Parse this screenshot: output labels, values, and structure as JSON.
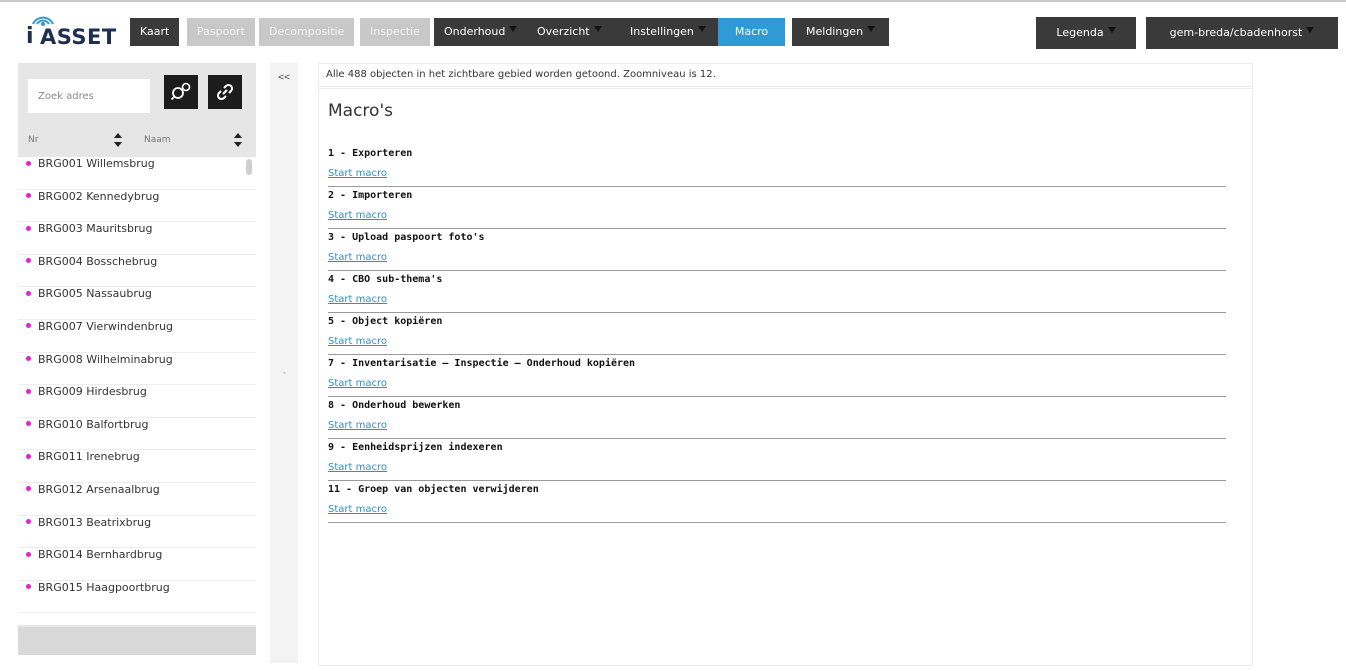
{
  "logo": {
    "text_i": "i",
    "text_asset": "ASSET"
  },
  "nav": {
    "kaart": "Kaart",
    "paspoort": "Paspoort",
    "decompositie": "Decompositie",
    "inspectie": "Inspectie",
    "onderhoud": "Onderhoud",
    "overzicht": "Overzicht",
    "instellingen": "Instellingen",
    "macro": "Macro",
    "meldingen": "Meldingen",
    "legenda": "Legenda",
    "user": "gem-breda/cbadenhorst"
  },
  "sidebar": {
    "search_placeholder": "Zoek adres",
    "sort_nr": "Nr",
    "sort_naam": "Naam",
    "items": [
      "BRG001 Willemsbrug",
      "BRG002 Kennedybrug",
      "BRG003 Mauritsbrug",
      "BRG004 Bosschebrug",
      "BRG005 Nassaubrug",
      "BRG007 Vierwindenbrug",
      "BRG008 Wilhelminabrug",
      "BRG009 Hirdesbrug",
      "BRG010 Balfortbrug",
      "BRG011 Irenebrug",
      "BRG012 Arsenaalbrug",
      "BRG013 Beatrixbrug",
      "BRG014 Bernhardbrug",
      "BRG015 Haagpoortbrug"
    ],
    "collapse_label": "<<"
  },
  "main": {
    "info": "Alle 488 objecten in het zichtbare gebied worden getoond. Zoomniveau is 12.",
    "title": "Macro's",
    "link_label": "Start macro",
    "macros": [
      "1 - Exporteren",
      "2 - Importeren",
      "3 - Upload paspoort foto's",
      "4 - CBO sub-thema's",
      "5 - Object kopiëren",
      "7 - Inventarisatie – Inspectie – Onderhoud kopiëren",
      "8 - Onderhoud bewerken",
      "9 - Eenheidsprijzen indexeren",
      "11 - Groep van objecten verwijderen"
    ]
  },
  "colors": {
    "nav_dark": "#3a3a3a",
    "nav_disabled": "#c8c8c8",
    "nav_active": "#2f9ad6",
    "link": "#2e8fcf",
    "marker": "#e41fd6"
  }
}
